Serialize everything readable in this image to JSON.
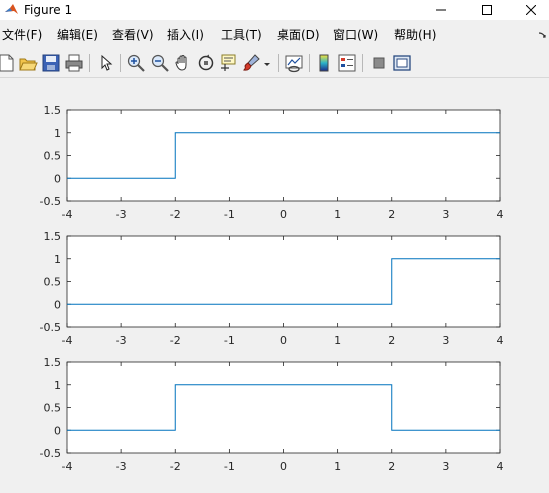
{
  "window": {
    "title": "Figure 1",
    "minimize_glyph": "—",
    "maximize_glyph": "☐",
    "close_glyph": "✕"
  },
  "menu": {
    "items": [
      {
        "label": "文件(F)",
        "name": "menu-file"
      },
      {
        "label": "编辑(E)",
        "name": "menu-edit"
      },
      {
        "label": "查看(V)",
        "name": "menu-view"
      },
      {
        "label": "插入(I)",
        "name": "menu-insert"
      },
      {
        "label": "工具(T)",
        "name": "menu-tools"
      },
      {
        "label": "桌面(D)",
        "name": "menu-desktop"
      },
      {
        "label": "窗口(W)",
        "name": "menu-window"
      },
      {
        "label": "帮助(H)",
        "name": "menu-help"
      }
    ],
    "overflow_icon": "arrow-icon"
  },
  "toolbar": {
    "icons": [
      "new-figure-icon",
      "open-file-icon",
      "save-icon",
      "print-icon",
      "edit-plot-arrow-icon",
      "zoom-in-icon",
      "zoom-out-icon",
      "pan-hand-icon",
      "rotate-3d-icon",
      "data-cursor-icon",
      "brush-icon",
      "link-plot-icon",
      "colorbar-icon",
      "legend-icon",
      "hide-plot-tools-icon",
      "show-plot-tools-icon"
    ]
  },
  "colors": {
    "line": "#0072BD",
    "axes_bg": "#ffffff",
    "figure_bg": "#f0f0f0",
    "axis": "#262626"
  },
  "chart_data": [
    {
      "type": "line",
      "xlim": [
        -4,
        4
      ],
      "ylim": [
        -0.5,
        1.5
      ],
      "xticks": [
        "-4",
        "-3",
        "-2",
        "-1",
        "0",
        "1",
        "2",
        "3",
        "4"
      ],
      "yticks": [
        "-0.5",
        "0",
        "0.5",
        "1",
        "1.5"
      ],
      "grid": false,
      "series": [
        {
          "x": [
            -4,
            -2,
            -2,
            4
          ],
          "y": [
            0,
            0,
            1,
            1
          ]
        }
      ]
    },
    {
      "type": "line",
      "xlim": [
        -4,
        4
      ],
      "ylim": [
        -0.5,
        1.5
      ],
      "xticks": [
        "-4",
        "-3",
        "-2",
        "-1",
        "0",
        "1",
        "2",
        "3",
        "4"
      ],
      "yticks": [
        "-0.5",
        "0",
        "0.5",
        "1",
        "1.5"
      ],
      "grid": false,
      "series": [
        {
          "x": [
            -4,
            2,
            2,
            4
          ],
          "y": [
            0,
            0,
            1,
            1
          ]
        }
      ]
    },
    {
      "type": "line",
      "xlim": [
        -4,
        4
      ],
      "ylim": [
        -0.5,
        1.5
      ],
      "xticks": [
        "-4",
        "-3",
        "-2",
        "-1",
        "0",
        "1",
        "2",
        "3",
        "4"
      ],
      "yticks": [
        "-0.5",
        "0",
        "0.5",
        "1",
        "1.5"
      ],
      "grid": false,
      "series": [
        {
          "x": [
            -4,
            -2,
            -2,
            2,
            2,
            4
          ],
          "y": [
            0,
            0,
            1,
            1,
            0,
            0
          ]
        }
      ]
    }
  ]
}
